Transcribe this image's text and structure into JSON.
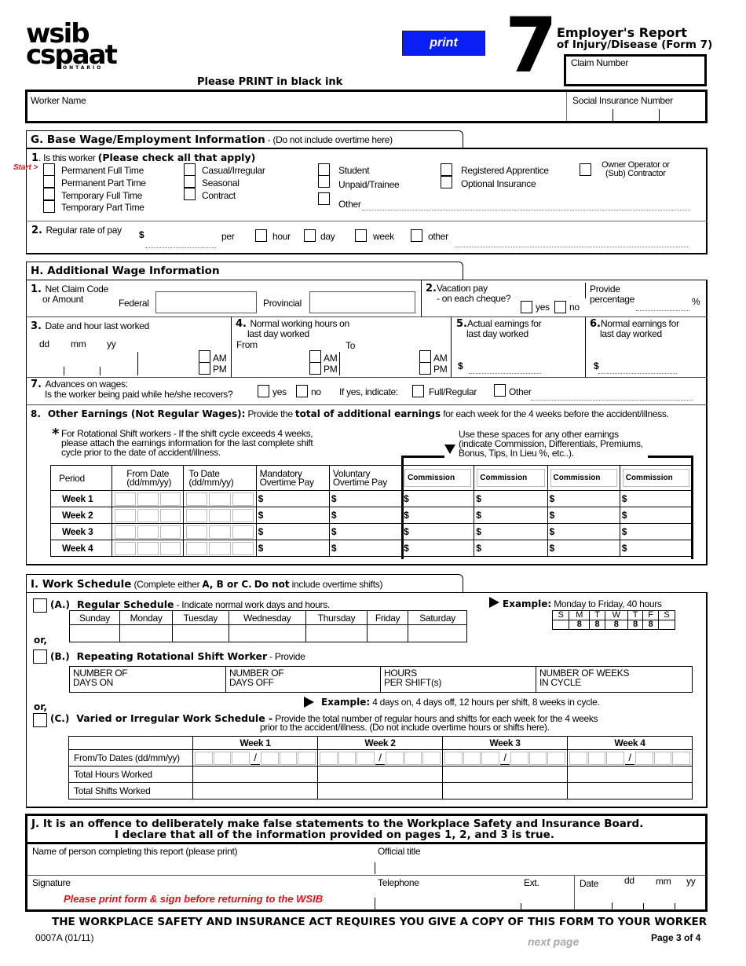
{
  "header": {
    "logo_line1": "wsib",
    "logo_line2": "cspaat",
    "logo_sub": "ONTARIO",
    "print_button": "print",
    "form_number": "7",
    "title_line1": "Employer's Report",
    "title_line2": "of Injury/Disease (Form 7)",
    "claim_number_label": "Claim Number",
    "print_instruction": "Please PRINT in black ink",
    "worker_name_label": "Worker Name",
    "sin_label": "Social Insurance Number"
  },
  "colors": {
    "print_button_bg": "#0a1ff5",
    "red_text": "#e8101a",
    "next_page_gray": "#aaaaaa"
  },
  "section_g": {
    "title": "G. Base Wage/Employment Information",
    "subtitle": " - (Do not include overtime here)",
    "q1_num": "1",
    "q1_text": ". Is this worker ",
    "q1_bold": "(Please check all that apply)",
    "start_marker": "Start >",
    "col1": [
      "Permanent Full Time",
      "Permanent Part Time",
      "Temporary Full Time",
      "Temporary Part Time"
    ],
    "col2": [
      "Casual/Irregular",
      "Seasonal",
      "Contract"
    ],
    "col3": [
      "Student",
      "Unpaid/Trainee",
      "Other"
    ],
    "col4": [
      "Registered Apprentice",
      "Optional Insurance"
    ],
    "col5_line1": "Owner Operator or",
    "col5_line2": "(Sub) Contractor",
    "q2_num": "2.",
    "q2_text": "Regular rate of pay",
    "dollar": "$",
    "per": "per",
    "per_options": [
      "hour",
      "day",
      "week",
      "other"
    ]
  },
  "section_h": {
    "title": "H. Additional Wage Information",
    "q1_num": "1.",
    "q1_line1": "Net Claim Code",
    "q1_line2": "or Amount",
    "federal": "Federal",
    "provincial": "Provincial",
    "q2_num": "2.",
    "q2_line1": "Vacation pay",
    "q2_line2": "- on each cheque?",
    "yes": "yes",
    "no": "no",
    "provide": "Provide",
    "percentage": "percentage",
    "percent_sign": "%",
    "q3_num": "3.",
    "q3_text": "Date and hour last worked",
    "dd": "dd",
    "mm": "mm",
    "yy": "yy",
    "am": "AM",
    "pm": "PM",
    "q4_num": "4.",
    "q4_line1": "Normal working hours on",
    "q4_line2": "last day worked",
    "from": "From",
    "to": "To",
    "q5_num": "5.",
    "q5_line1": "Actual earnings for",
    "q5_line2": "last day worked",
    "q6_num": "6.",
    "q6_line1": "Normal earnings for",
    "q6_line2": "last day worked",
    "dollar": "$",
    "q7_num": "7.",
    "q7_line1": "Advances on wages:",
    "q7_line2": "Is the worker being paid while he/she recovers?",
    "if_yes": "If yes, indicate:",
    "full_regular": "Full/Regular",
    "other": "Other",
    "q8_num": "8.",
    "q8_title": "Other Earnings (Not Regular Wages):",
    "q8_text1": " Provide the ",
    "q8_bold": "total of additional earnings",
    "q8_text2": " for each week for the 4 weeks before  the accident/illness.",
    "rot_star": "*",
    "rot_line1": "For Rotational Shift workers - If the shift cycle exceeds 4 weeks,",
    "rot_line2": "please attach the earnings information for the last complete shift",
    "rot_line3": "cycle prior to the date of accident/illness.",
    "other_line1": "Use these spaces for any other earnings",
    "other_line2": "(indicate Commission, Differentials, Premiums,",
    "other_line3": "Bonus, Tips, In Lieu %, etc..).",
    "table_headers": {
      "period": "Period",
      "from_date": "From Date",
      "from_fmt": "(dd/mm/yy)",
      "to_date": "To Date",
      "to_fmt": "(dd/mm/yy)",
      "mandatory1": "Mandatory",
      "mandatory2": "Overtime Pay",
      "voluntary1": "Voluntary",
      "voluntary2": "Overtime Pay",
      "commission": [
        "Commission",
        "Commission",
        "Commission",
        "Commission"
      ]
    },
    "weeks": [
      "Week 1",
      "Week 2",
      "Week 3",
      "Week 4"
    ]
  },
  "section_i": {
    "title": "I. Work Schedule",
    "subtitle_pre": " (Complete either ",
    "subtitle_b1": "A, B or C.",
    "subtitle_mid": " ",
    "subtitle_b2": "Do not",
    "subtitle_post": " include overtime shifts)",
    "a_label": "(A.)",
    "a_title": "Regular Schedule",
    "a_text": " - Indicate normal work days and hours.",
    "days": [
      "Sunday",
      "Monday",
      "Tuesday",
      "Wednesday",
      "Thursday",
      "Friday",
      "Saturday"
    ],
    "example_label": "Example:",
    "example_a_text": " Monday to Friday, 40 hours",
    "example_days": [
      "S",
      "M",
      "T",
      "W",
      "T",
      "F",
      "S"
    ],
    "example_hours": [
      "",
      "8",
      "8",
      "8",
      "8",
      "8",
      ""
    ],
    "or": "or,",
    "b_label": "(B.)",
    "b_title": "Repeating Rotational Shift Worker",
    "b_text": " -  Provide",
    "b_fields": [
      {
        "line1": "NUMBER  OF",
        "line2": "DAYS ON"
      },
      {
        "line1": "NUMBER OF",
        "line2": "DAYS OFF"
      },
      {
        "line1": "HOURS",
        "line2": "PER SHIFT(s)"
      },
      {
        "line1": "NUMBER OF WEEKS",
        "line2": "IN CYCLE"
      }
    ],
    "example_b_text": " 4 days on, 4 days off, 12 hours per shift, 8 weeks in cycle.",
    "c_label": "(C.)",
    "c_title": "Varied or Irregular Work Schedule -",
    "c_line1": " Provide the total number of regular hours and shifts for each week for the  4 weeks",
    "c_line2": "prior to the accident/illness.   (Do not include overtime hours or shifts here).",
    "c_weeks": [
      "Week 1",
      "Week 2",
      "Week 3",
      "Week 4"
    ],
    "c_rows": [
      "From/To Dates (dd/mm/yy)",
      "Total Hours Worked",
      "Total Shifts Worked"
    ],
    "slash": "/"
  },
  "section_j": {
    "line1": "J.  It is an offence to deliberately make false statements to the Workplace Safety and Insurance Board.",
    "line2": "I declare that all of the information provided on pages 1, 2, and 3 is true.",
    "name_label": "Name of person completing this report  (please print)",
    "official_title": "Official title",
    "signature": "Signature",
    "telephone": "Telephone",
    "ext": "Ext.",
    "date": "Date",
    "dd": "dd",
    "mm": "mm",
    "yy": "yy",
    "red_notice": "Please print form & sign before returning to the WSIB"
  },
  "footer": {
    "act_notice": "THE WORKPLACE SAFETY AND INSURANCE ACT REQUIRES YOU GIVE A COPY OF THIS FORM TO YOUR WORKER",
    "form_code": "0007A (01/11)",
    "next_page": "next page",
    "page": "Page 3 of 4"
  }
}
